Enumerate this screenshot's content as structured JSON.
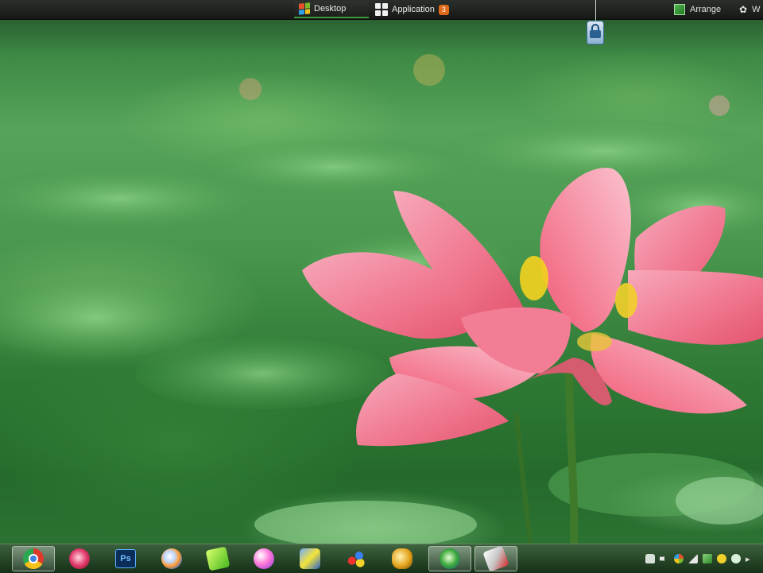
{
  "top_bar": {
    "tabs": [
      {
        "label": "Desktop",
        "icon": "windows-flag-icon",
        "active": true
      },
      {
        "label": "Application",
        "icon": "app-grid-icon",
        "badge": "3"
      }
    ],
    "arrange_label": "Arrange",
    "extra_label": "W"
  },
  "taskbar": {
    "apps": [
      {
        "icon": "chrome-icon",
        "active": true
      },
      {
        "icon": "gold-app-icon"
      },
      {
        "icon": "photoshop-icon",
        "label": "Ps"
      },
      {
        "icon": "swirl-app-icon"
      },
      {
        "icon": "green-app-icon"
      },
      {
        "icon": "pink-ball-icon"
      },
      {
        "icon": "network-app-icon"
      },
      {
        "icon": "color-balls-icon"
      },
      {
        "icon": "coin-app-icon"
      },
      {
        "icon": "globe-ring-icon",
        "active": true
      },
      {
        "icon": "feather-app-icon",
        "active": true
      }
    ],
    "tray": [
      "lock-icon",
      "speaker-icon",
      "windows-flag-icon",
      "signal-icon",
      "network-icon",
      "update-icon",
      "clock-icon",
      "more-icon"
    ]
  },
  "colors": {
    "accent": "#3c9a3c",
    "badge": "#e06a1a",
    "flower": "#ef6f8a"
  }
}
